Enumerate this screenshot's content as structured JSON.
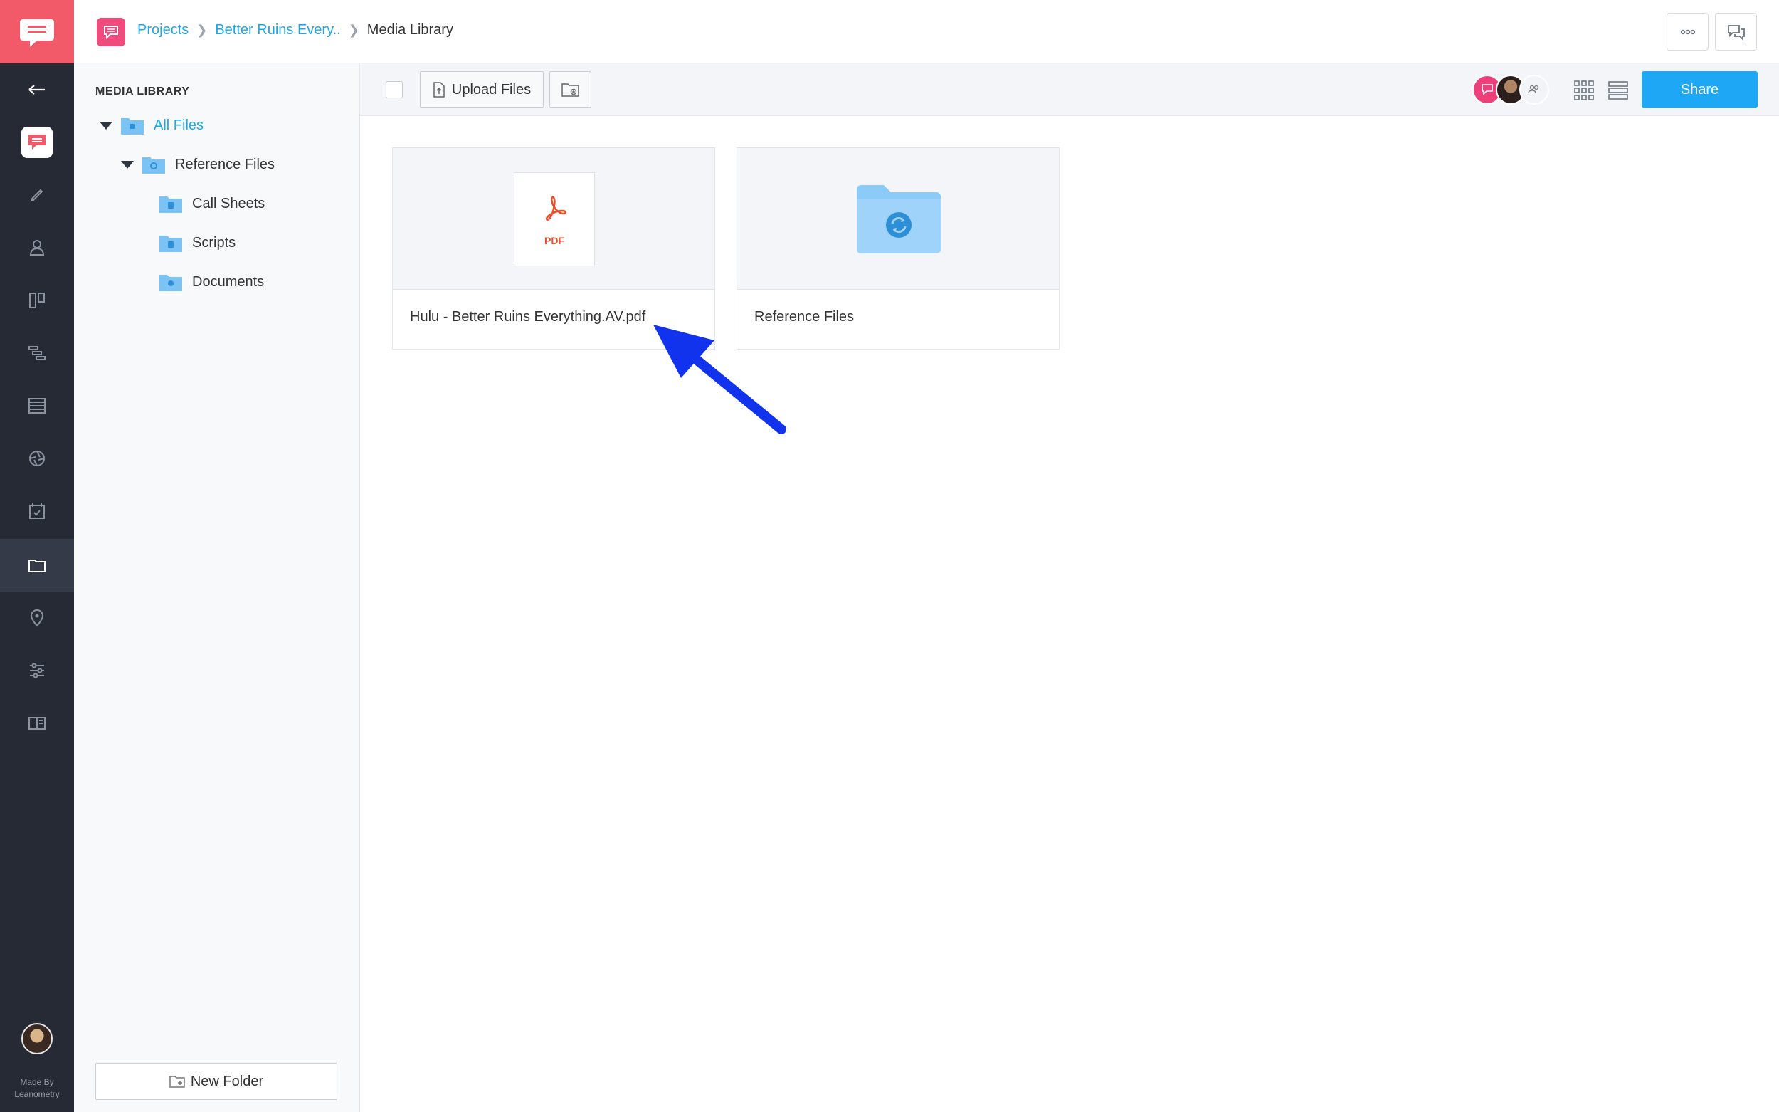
{
  "rail": {
    "items": [
      {
        "icon": "back-arrow-icon"
      },
      {
        "icon": "app-logo-icon"
      },
      {
        "icon": "pencil-icon"
      },
      {
        "icon": "user-icon"
      },
      {
        "icon": "board-icon"
      },
      {
        "icon": "timeline-icon"
      },
      {
        "icon": "list-icon"
      },
      {
        "icon": "aperture-icon"
      },
      {
        "icon": "calendar-check-icon"
      },
      {
        "icon": "folder-icon",
        "active": true
      },
      {
        "icon": "location-pin-icon"
      },
      {
        "icon": "sliders-icon"
      },
      {
        "icon": "script-book-icon"
      }
    ],
    "made_by": "Made By",
    "made_by_company": "Leanometry"
  },
  "header": {
    "breadcrumbs": [
      "Projects",
      "Better Ruins Every..",
      "Media Library"
    ],
    "more_icon": "ellipsis-icon",
    "chat_icon": "chat-bubbles-icon"
  },
  "sidebar": {
    "title": "MEDIA LIBRARY",
    "tree": [
      {
        "label": "All Files",
        "level": 0,
        "expanded": true,
        "active": true
      },
      {
        "label": "Reference Files",
        "level": 1,
        "expanded": true
      },
      {
        "label": "Call Sheets",
        "level": 2
      },
      {
        "label": "Scripts",
        "level": 2
      },
      {
        "label": "Documents",
        "level": 2
      }
    ],
    "new_folder_label": "New Folder"
  },
  "toolbar": {
    "upload_label": "Upload Files",
    "share_label": "Share"
  },
  "files": [
    {
      "name": "Hulu - Better Ruins Everything.AV.pdf",
      "type": "pdf",
      "badge": "PDF"
    },
    {
      "name": "Reference Files",
      "type": "folder"
    }
  ],
  "colors": {
    "rail_bg": "#252a35",
    "brand": "#f25a6a",
    "link": "#1ea7e8",
    "share": "#1ea7f5",
    "annotation_arrow": "#1133ee"
  }
}
